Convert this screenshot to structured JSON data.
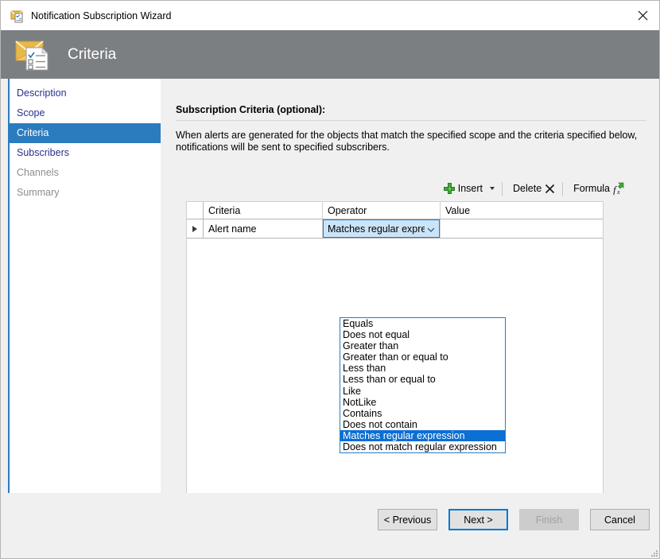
{
  "window": {
    "title": "Notification Subscription Wizard",
    "title_icon": "envelope-document-icon",
    "close_icon": "close-icon"
  },
  "header": {
    "title": "Criteria",
    "icon": "envelope-checklist-icon",
    "background": "#7b7f82"
  },
  "sidebar": {
    "accent": "#2b7cbf",
    "items": [
      {
        "label": "Description",
        "state": "link"
      },
      {
        "label": "Scope",
        "state": "link"
      },
      {
        "label": "Criteria",
        "state": "active"
      },
      {
        "label": "Subscribers",
        "state": "link"
      },
      {
        "label": "Channels",
        "state": "muted"
      },
      {
        "label": "Summary",
        "state": "muted"
      }
    ]
  },
  "content": {
    "section_title": "Subscription Criteria (optional):",
    "description": "When alerts are generated for the objects that match the specified scope and the criteria specified below, notifications will be sent to specified subscribers."
  },
  "toolbar": {
    "insert_label": "Insert",
    "insert_icon": "green-plus-icon",
    "insert_caret_icon": "chevron-down-icon",
    "delete_label": "Delete",
    "delete_icon": "x-icon",
    "formula_label": "Formula",
    "formula_icon": "fx-green-arrow-icon"
  },
  "grid": {
    "columns": [
      "",
      "Criteria",
      "Operator",
      "Value"
    ],
    "rows": [
      {
        "selected": true,
        "criteria": "Alert name",
        "operator": "Matches regular expression",
        "value": ""
      }
    ]
  },
  "operator_dropdown": {
    "open": true,
    "selected": "Matches regular expression",
    "highlight_color": "#0b6fd4",
    "options": [
      "Equals",
      "Does not equal",
      "Greater than",
      "Greater than or equal to",
      "Less than",
      "Less than or equal to",
      "Like",
      "NotLike",
      "Contains",
      "Does not contain",
      "Matches regular expression",
      "Does not match regular expression"
    ]
  },
  "footer": {
    "buttons": [
      {
        "label": "< Previous",
        "state": "normal"
      },
      {
        "label": "Next >",
        "state": "focus"
      },
      {
        "label": "Finish",
        "state": "disabled"
      },
      {
        "label": "Cancel",
        "state": "normal"
      }
    ]
  }
}
